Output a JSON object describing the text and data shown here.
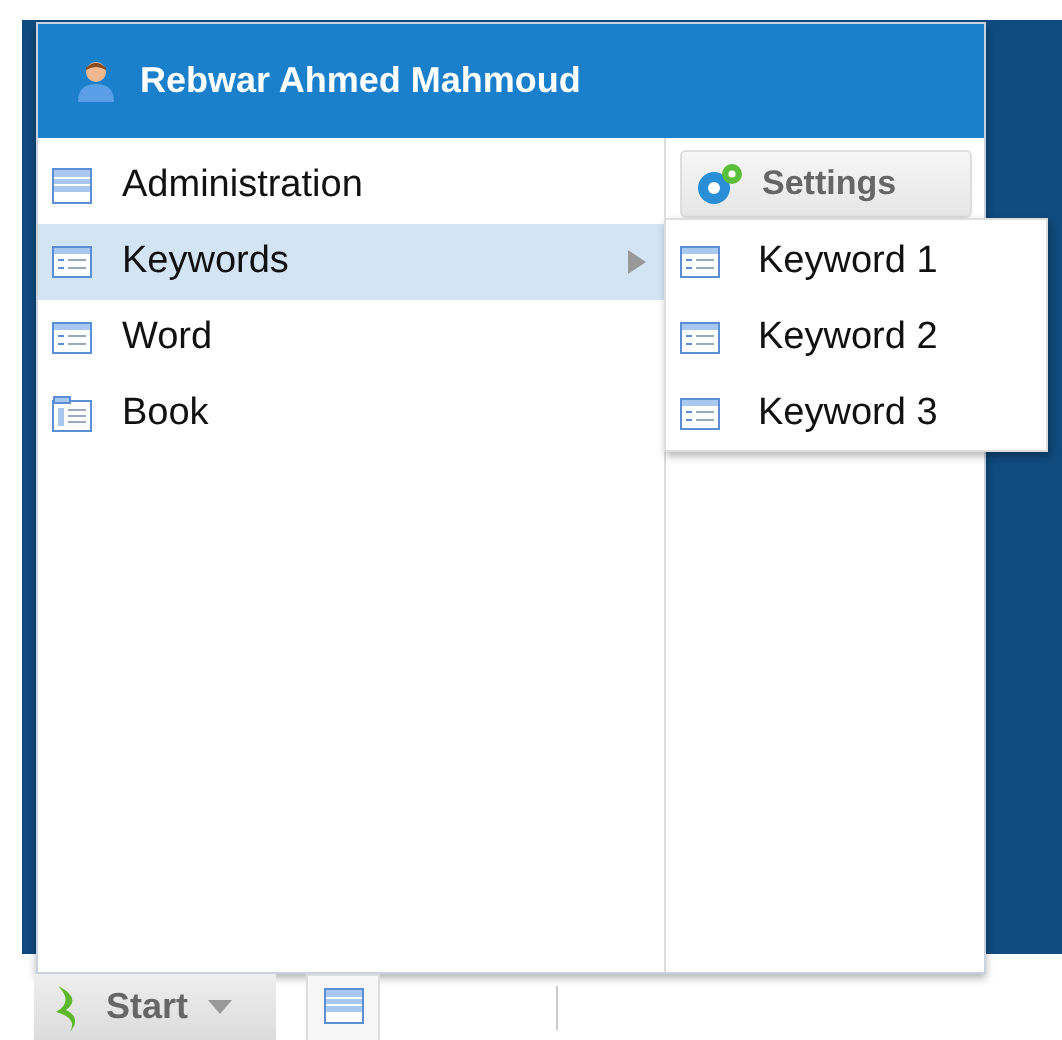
{
  "user": {
    "name": "Rebwar Ahmed Mahmoud"
  },
  "menu_items": [
    {
      "label": "Administration",
      "kind": "table",
      "submenu": false,
      "selected": false
    },
    {
      "label": "Keywords",
      "kind": "form",
      "submenu": true,
      "selected": true
    },
    {
      "label": "Word",
      "kind": "form",
      "submenu": false,
      "selected": false
    },
    {
      "label": "Book",
      "kind": "book",
      "submenu": false,
      "selected": false
    }
  ],
  "settings_button": {
    "label": "Settings"
  },
  "submenu": {
    "items": [
      {
        "label": "Keyword 1",
        "kind": "form"
      },
      {
        "label": "Keyword 2",
        "kind": "form"
      },
      {
        "label": "Keyword 3",
        "kind": "form"
      }
    ]
  },
  "taskbar": {
    "start_button": {
      "label": "Start"
    }
  }
}
